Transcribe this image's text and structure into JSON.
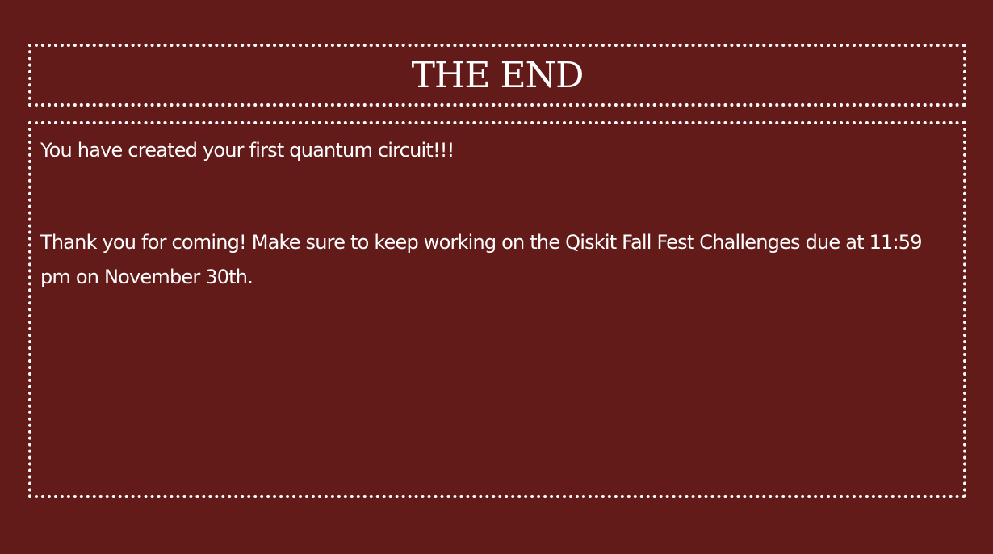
{
  "slide": {
    "title": "THE END",
    "paragraph_1": "You have created your first quantum circuit!!!",
    "paragraph_2": "Thank you for coming! Make sure to keep working on the Qiskit Fall Fest Challenges due at 11:59 pm on November 30th."
  },
  "colors": {
    "background": "#621b19",
    "text": "#ffffff",
    "border": "#ffffff"
  }
}
